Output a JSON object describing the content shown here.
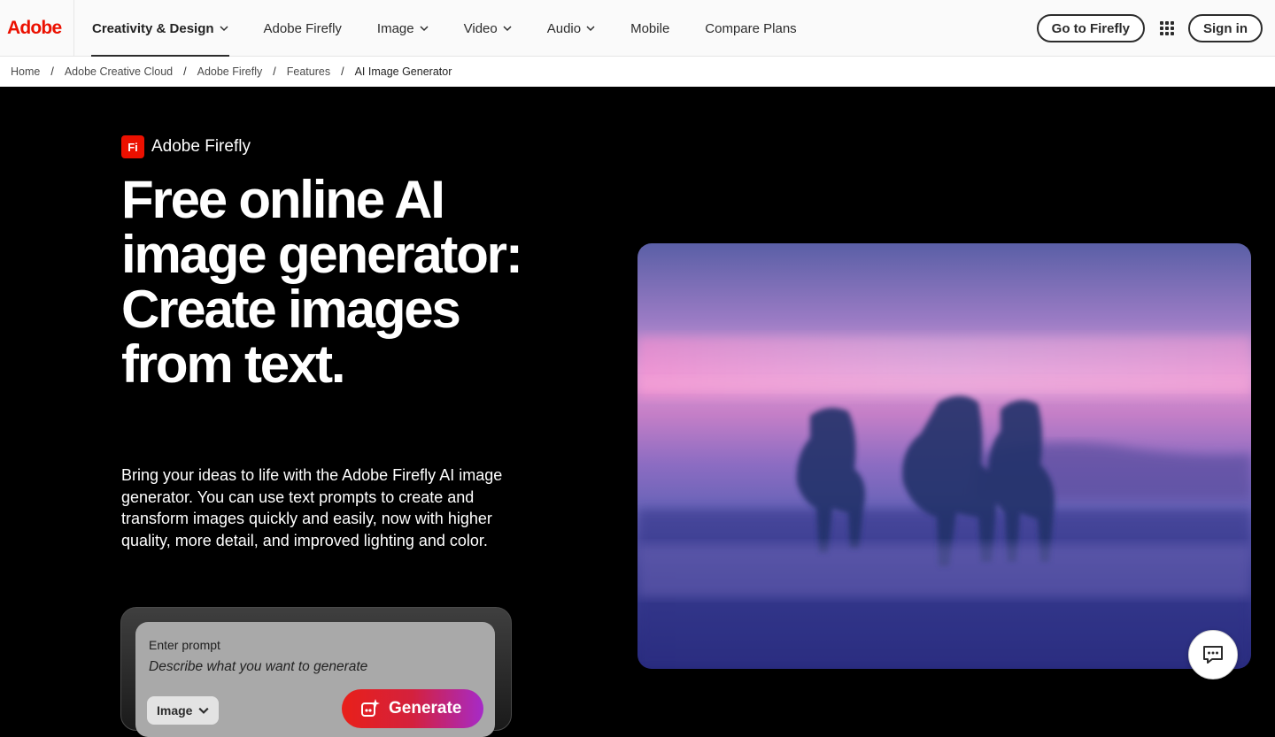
{
  "brand": {
    "logo_text": "Adobe",
    "logo_color": "#eb1000"
  },
  "nav": {
    "items": [
      {
        "label": "Creativity & Design",
        "has_menu": true,
        "active": true
      },
      {
        "label": "Adobe Firefly",
        "has_menu": false
      },
      {
        "label": "Image",
        "has_menu": true
      },
      {
        "label": "Video",
        "has_menu": true
      },
      {
        "label": "Audio",
        "has_menu": true
      },
      {
        "label": "Mobile",
        "has_menu": false
      },
      {
        "label": "Compare Plans",
        "has_menu": false
      }
    ],
    "go_to_firefly": "Go to Firefly",
    "apps_icon": "app-grid-icon",
    "sign_in": "Sign in"
  },
  "breadcrumb": {
    "items": [
      "Home",
      "Adobe Creative Cloud",
      "Adobe Firefly",
      "Features",
      "AI Image Generator"
    ],
    "separator": "/"
  },
  "hero": {
    "product_badge": "Fi",
    "product_name": "Adobe Firefly",
    "headline": "Free online AI image generator: Create images from text.",
    "description": "Bring your ideas to life with the Adobe Firefly AI image generator. You can use text prompts to create and transform images quickly and easily, now with higher quality, more detail, and improved lighting and color.",
    "image_alt": "Horses running through water at dusk under a pink and purple sky"
  },
  "prompt": {
    "label": "Enter prompt",
    "placeholder": "Describe what you want to generate",
    "type_selected": "Image",
    "generate_label": "Generate",
    "generate_icon": "sparkle-generate-icon"
  },
  "chat": {
    "icon": "chat-bubble-icon"
  },
  "colors": {
    "accent_red": "#eb1000",
    "generate_gradient_end": "#a62ac8"
  }
}
